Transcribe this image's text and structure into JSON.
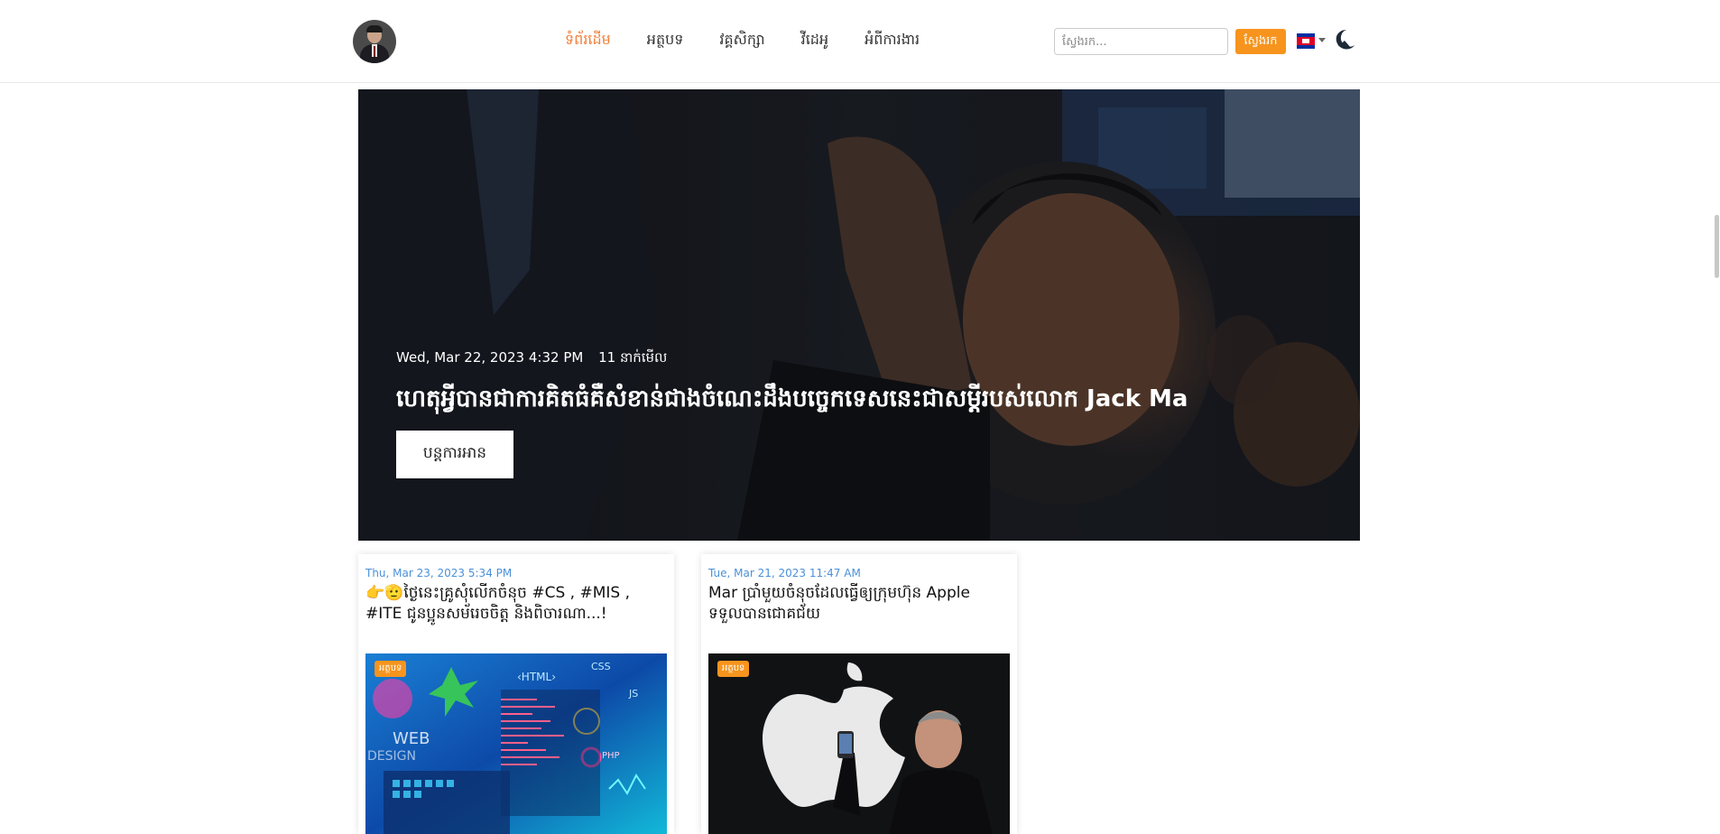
{
  "header": {
    "nav": [
      {
        "label": "ទំព័រដើម",
        "active": true
      },
      {
        "label": "អត្ថបទ",
        "active": false
      },
      {
        "label": "វគ្គសិក្សា",
        "active": false
      },
      {
        "label": "វីដេអូ",
        "active": false
      },
      {
        "label": "អំពីការងារ",
        "active": false
      }
    ],
    "search": {
      "placeholder": "ស្វែងរក...",
      "button_label": "ស្វែងរក"
    },
    "language": "flag-cambodia-icon",
    "accent_color": "#f0803c"
  },
  "hero": {
    "date": "Wed, Mar 22, 2023 4:32 PM",
    "views": "11 នាក់មើល",
    "title": "ហេតុអ្វីបានជាការគិតធំគឺសំខាន់ជាងចំណេះដឹងបច្ចេកទេសនេះជាសម្ដីរបស់លោក Jack Ma",
    "button_label": "បន្តការអាន"
  },
  "cards": [
    {
      "date": "Thu, Mar 23, 2023 5:34 PM",
      "title": "👉🫡ថ្ងៃនេះគ្រូសុំលើកចំនុច #CS , #MIS , #ITE ជូនប្អូនសម័រេចចិត្ត និងពិចារណា...!",
      "badge": "អត្ថបទ",
      "image": "web-design-illustration"
    },
    {
      "date": "Tue, Mar 21, 2023 11:47 AM",
      "title": "Mar ប្រាំមួយចំនុចដែលធ្វើឲ្យក្រុមហ៊ុន Apple ទទួលបានជោគជ័យ",
      "badge": "អត្ថបទ",
      "image": "steve-jobs-apple-photo"
    }
  ]
}
